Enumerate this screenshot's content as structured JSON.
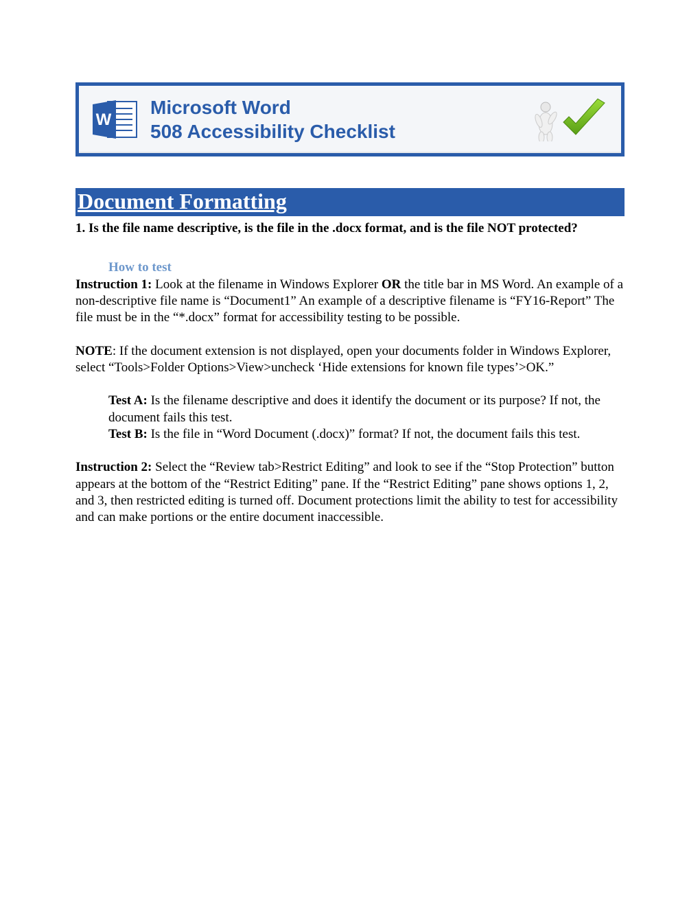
{
  "banner": {
    "line1": "Microsoft Word",
    "line2": "508 Accessibility Checklist"
  },
  "section": {
    "title": "Document Formatting",
    "question": "1. Is the file name descriptive, is the file in the .docx format, and is the file NOT protected?",
    "howToTest": "How to test",
    "instruction1Label": "Instruction 1:",
    "instruction1a": " Look at the filename in Windows Explorer ",
    "instruction1or": "OR",
    "instruction1b": " the title bar in MS Word. An example of a non-descriptive file name is “Document1” An example of a descriptive filename is “FY16-Report” The file must be in the “*.docx” format for accessibility testing to be possible.",
    "noteLabel": "NOTE",
    "noteText": ": If the document extension is not displayed, open your documents folder in Windows Explorer, select “Tools>Folder Options>View>uncheck ‘Hide extensions for known file types’>OK.”",
    "testALabel": "Test A:",
    "testAText": " Is the filename descriptive and does it identify the document or its purpose? If not, the document fails this test.",
    "testBLabel": "Test B:",
    "testBText": " Is the file in “Word Document (.docx)” format? If not, the document fails this test.",
    "instruction2Label": "Instruction 2:",
    "instruction2Text": " Select the “Review tab>Restrict Editing” and look to see if the “Stop Protection” button appears at the bottom of the “Restrict Editing” pane. If the “Restrict Editing” pane shows options 1, 2, and 3, then restricted editing is turned off. Document protections limit the ability to test for accessibility and can make portions or the entire document inaccessible."
  }
}
